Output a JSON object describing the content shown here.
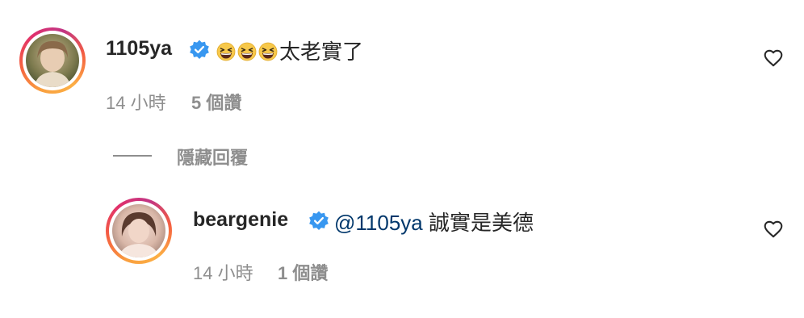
{
  "comments": [
    {
      "username": "1105ya",
      "verified": true,
      "emoji_count": 3,
      "emoji_icon": "grinning-squinting-face-icon",
      "text": "太老實了",
      "time": "14 小時",
      "likes": "5 個讚"
    }
  ],
  "replies_toggle": {
    "label": "隱藏回覆"
  },
  "replies": [
    {
      "username": "beargenie",
      "verified": true,
      "mention": "@1105ya",
      "text": "誠實是美德",
      "time": "14 小時",
      "likes": "1 個讚"
    }
  ],
  "colors": {
    "verified_blue": "#3897f0",
    "mention_blue": "#00376b",
    "meta_gray": "#8e8e8e",
    "text_dark": "#262626"
  }
}
